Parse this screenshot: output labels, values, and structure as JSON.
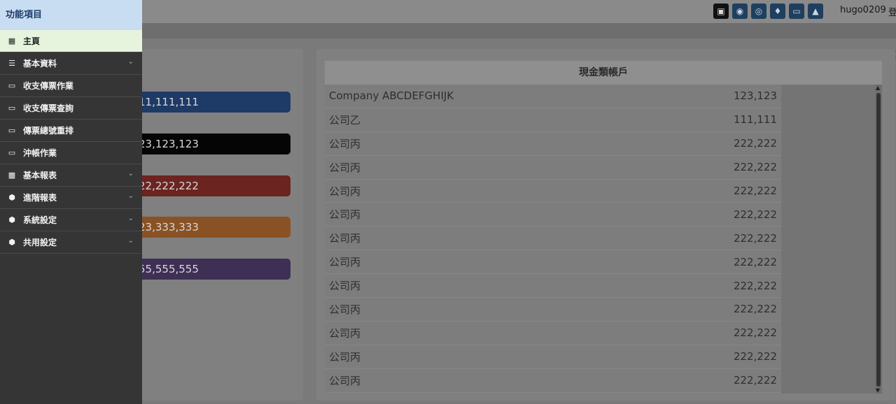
{
  "header": {
    "icons": [
      "screenshot-icon",
      "palette-icon",
      "globe-icon",
      "bell-icon",
      "lock-icon",
      "sitemap-icon"
    ],
    "username": "hugo0209",
    "login_label": "登"
  },
  "sidebar": {
    "title": "功能項目",
    "items": [
      {
        "label": "主頁",
        "icon": "grid-icon",
        "active": true,
        "expandable": false
      },
      {
        "label": "基本資料",
        "icon": "layers-icon",
        "active": false,
        "expandable": true
      },
      {
        "label": "收支傳票作業",
        "icon": "inbox-icon",
        "active": false,
        "expandable": false
      },
      {
        "label": "收支傳票查詢",
        "icon": "inbox-icon",
        "active": false,
        "expandable": false
      },
      {
        "label": "傳票總號重排",
        "icon": "inbox-icon",
        "active": false,
        "expandable": false
      },
      {
        "label": "沖帳作業",
        "icon": "inbox-icon",
        "active": false,
        "expandable": false
      },
      {
        "label": "基本報表",
        "icon": "dashboard-icon",
        "active": false,
        "expandable": true
      },
      {
        "label": "進階報表",
        "icon": "cube-icon",
        "active": false,
        "expandable": true
      },
      {
        "label": "系統設定",
        "icon": "cube-icon",
        "active": false,
        "expandable": true
      },
      {
        "label": "共用設定",
        "icon": "cube-icon",
        "active": false,
        "expandable": true
      }
    ]
  },
  "stats": [
    {
      "value": "11,111,111",
      "color": "#1e3a66"
    },
    {
      "value": "23,123,123",
      "color": "#050505"
    },
    {
      "value": "22,222,222",
      "color": "#6b2420"
    },
    {
      "value": "23,333,333",
      "color": "#8a5224"
    },
    {
      "value": "55,555,555",
      "color": "#3e2f55"
    }
  ],
  "cash_table": {
    "title": "現金類帳戶",
    "rows": [
      {
        "name": "Company ABCDEFGHIJK",
        "amount": "123,123"
      },
      {
        "name": "公司乙",
        "amount": "111,111"
      },
      {
        "name": "公司丙",
        "amount": "222,222"
      },
      {
        "name": "公司丙",
        "amount": "222,222"
      },
      {
        "name": "公司丙",
        "amount": "222,222"
      },
      {
        "name": "公司丙",
        "amount": "222,222"
      },
      {
        "name": "公司丙",
        "amount": "222,222"
      },
      {
        "name": "公司丙",
        "amount": "222,222"
      },
      {
        "name": "公司丙",
        "amount": "222,222"
      },
      {
        "name": "公司丙",
        "amount": "222,222"
      },
      {
        "name": "公司丙",
        "amount": "222,222"
      },
      {
        "name": "公司丙",
        "amount": "222,222"
      },
      {
        "name": "公司丙",
        "amount": "222,222"
      }
    ]
  }
}
